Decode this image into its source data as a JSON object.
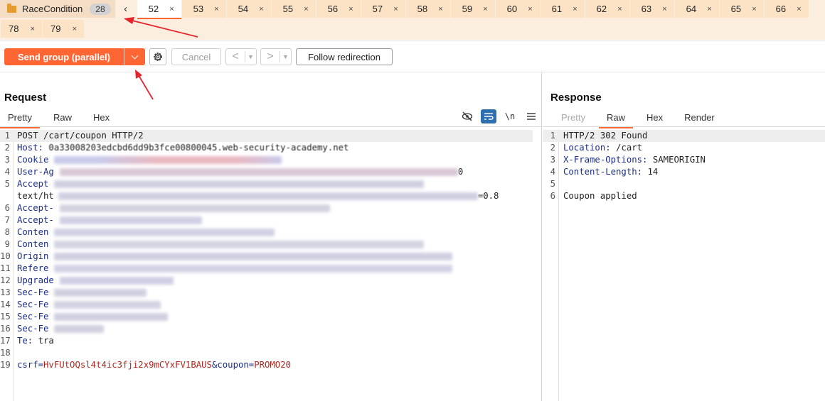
{
  "group": {
    "name": "RaceCondition",
    "count": "28",
    "collapse_icon": "chevron-left-icon"
  },
  "tabs_row1": [
    "52",
    "53",
    "54",
    "55",
    "56",
    "57",
    "58",
    "59",
    "60",
    "61",
    "62",
    "63",
    "64",
    "65",
    "66"
  ],
  "tabs_row2": [
    "78",
    "79"
  ],
  "active_tab": "52",
  "toolbar": {
    "send_label": "Send group (parallel)",
    "cancel_label": "Cancel",
    "prev_label": "<",
    "next_label": ">",
    "follow_label": "Follow redirection"
  },
  "request": {
    "title": "Request",
    "tabs": [
      "Pretty",
      "Raw",
      "Hex"
    ],
    "active_tab": "Pretty",
    "lines": [
      {
        "n": "1",
        "text": "POST /cart/coupon HTTP/2"
      },
      {
        "n": "2",
        "name": "Host:",
        "value": "0a33008203edcbd6dd9b3fce00800045.web-security-academy.net"
      },
      {
        "n": "3",
        "name": "Cookie"
      },
      {
        "n": "4",
        "name": "User-Ag",
        "tail": "0"
      },
      {
        "n": "5",
        "name": "Accept"
      },
      {
        "n": "",
        "text": "text/ht",
        "tail": "=0.8"
      },
      {
        "n": "6",
        "name": "Accept-"
      },
      {
        "n": "7",
        "name": "Accept-"
      },
      {
        "n": "8",
        "name": "Conten"
      },
      {
        "n": "9",
        "name": "Conten"
      },
      {
        "n": "10",
        "name": "Origin"
      },
      {
        "n": "11",
        "name": "Refere"
      },
      {
        "n": "12",
        "name": "Upgrade"
      },
      {
        "n": "13",
        "name": "Sec-Fe"
      },
      {
        "n": "14",
        "name": "Sec-Fe"
      },
      {
        "n": "15",
        "name": "Sec-Fe"
      },
      {
        "n": "16",
        "name": "Sec-Fe"
      },
      {
        "n": "17",
        "name": "Te:",
        "value": "tra"
      },
      {
        "n": "18",
        "text": ""
      },
      {
        "n": "19",
        "text": ""
      }
    ],
    "body": {
      "csrf_name": "csrf",
      "csrf_value": "HvFUtOQsl4t4ic3fji2x9mCYxFV1BAUS",
      "coupon_name": "coupon",
      "coupon_value": "PROMO20"
    }
  },
  "response": {
    "title": "Response",
    "tabs": [
      "Pretty",
      "Raw",
      "Hex",
      "Render"
    ],
    "active_tab": "Raw",
    "lines": [
      {
        "n": "1",
        "text": "HTTP/2 302 Found"
      },
      {
        "n": "2",
        "name": "Location:",
        "value": " /cart"
      },
      {
        "n": "3",
        "name": "X-Frame-Options:",
        "value": " SAMEORIGIN"
      },
      {
        "n": "4",
        "name": "Content-Length:",
        "value": " 14"
      },
      {
        "n": "5",
        "text": ""
      },
      {
        "n": "6",
        "text": "Coupon applied"
      }
    ]
  },
  "colors": {
    "accent": "#ff6633",
    "tabbar_bg": "#fbeede",
    "annotation": "#e8222a"
  }
}
